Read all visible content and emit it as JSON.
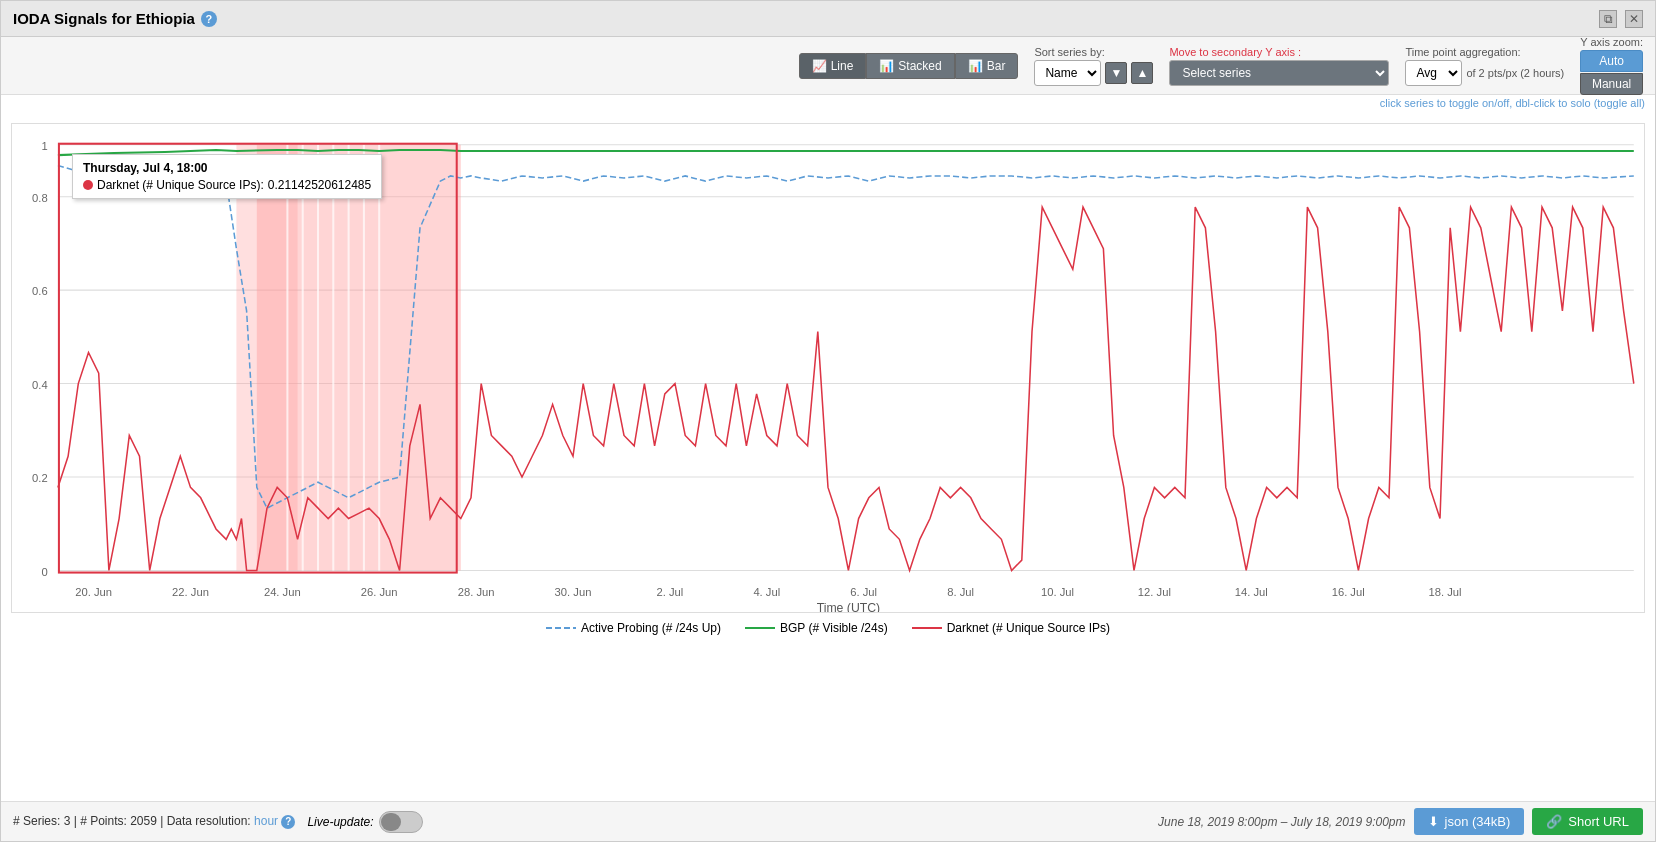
{
  "window": {
    "title": "IODA Signals for Ethiopia",
    "help_icon": "?",
    "close_icon": "✕",
    "maximize_icon": "⧉"
  },
  "toolbar": {
    "chart_types": [
      {
        "label": "Line",
        "icon": "📈",
        "active": true
      },
      {
        "label": "Stacked",
        "icon": "📊",
        "active": false
      },
      {
        "label": "Bar",
        "icon": "📊",
        "active": false
      }
    ],
    "sort_series": {
      "label": "Sort series by:",
      "value": "Name",
      "options": [
        "Name",
        "Value"
      ]
    },
    "secondary_axis": {
      "label_prefix": "Move to secondary",
      "label_highlight": "Y axis",
      "label_suffix": ":",
      "placeholder": "Select series"
    },
    "aggregation": {
      "label": "Time point aggregation:",
      "value": "Avg",
      "info": "of 2 pts/px (2 hours)"
    },
    "y_zoom": {
      "label": "Y axis zoom:",
      "options": [
        "Auto",
        "Manual"
      ],
      "active": "Auto"
    }
  },
  "chart": {
    "toggle_hint": "click series to toggle on/off, dbl-click to solo (toggle all)",
    "tooltip": {
      "date": "Thursday, Jul 4, 18:00",
      "series": "Darknet (# Unique Source IPs)",
      "value": "0.21142520612485",
      "color": "#dc3545"
    },
    "x_labels": [
      "20. Jun",
      "22. Jun",
      "24. Jun",
      "26. Jun",
      "28. Jun",
      "30. Jun",
      "2. Jul",
      "4. Jul",
      "6. Jul",
      "8. Jul",
      "10. Jul",
      "12. Jul",
      "14. Jul",
      "16. Jul",
      "18. Jul"
    ],
    "y_labels": [
      "0",
      "0.2",
      "0.4",
      "0.6",
      "0.8",
      "1"
    ],
    "x_axis_label": "Time (UTC)",
    "legend": [
      {
        "label": "Active Probing (# /24s Up)",
        "color": "#5b9bd5",
        "style": "dashed"
      },
      {
        "label": "BGP (# Visible /24s)",
        "color": "#28a745",
        "style": "solid"
      },
      {
        "label": "Darknet (# Unique Source IPs)",
        "color": "#dc3545",
        "style": "solid"
      }
    ]
  },
  "bottom_bar": {
    "stats": "# Series: 3 | # Points: 2059 | Data resolution: hour",
    "resolution_link": "hour",
    "live_update_label": "Live-update:",
    "date_range": "June 18, 2019 8:00pm – July 18, 2019 9:00pm",
    "json_btn": "json (34kB)",
    "short_url_btn": "Short URL"
  }
}
